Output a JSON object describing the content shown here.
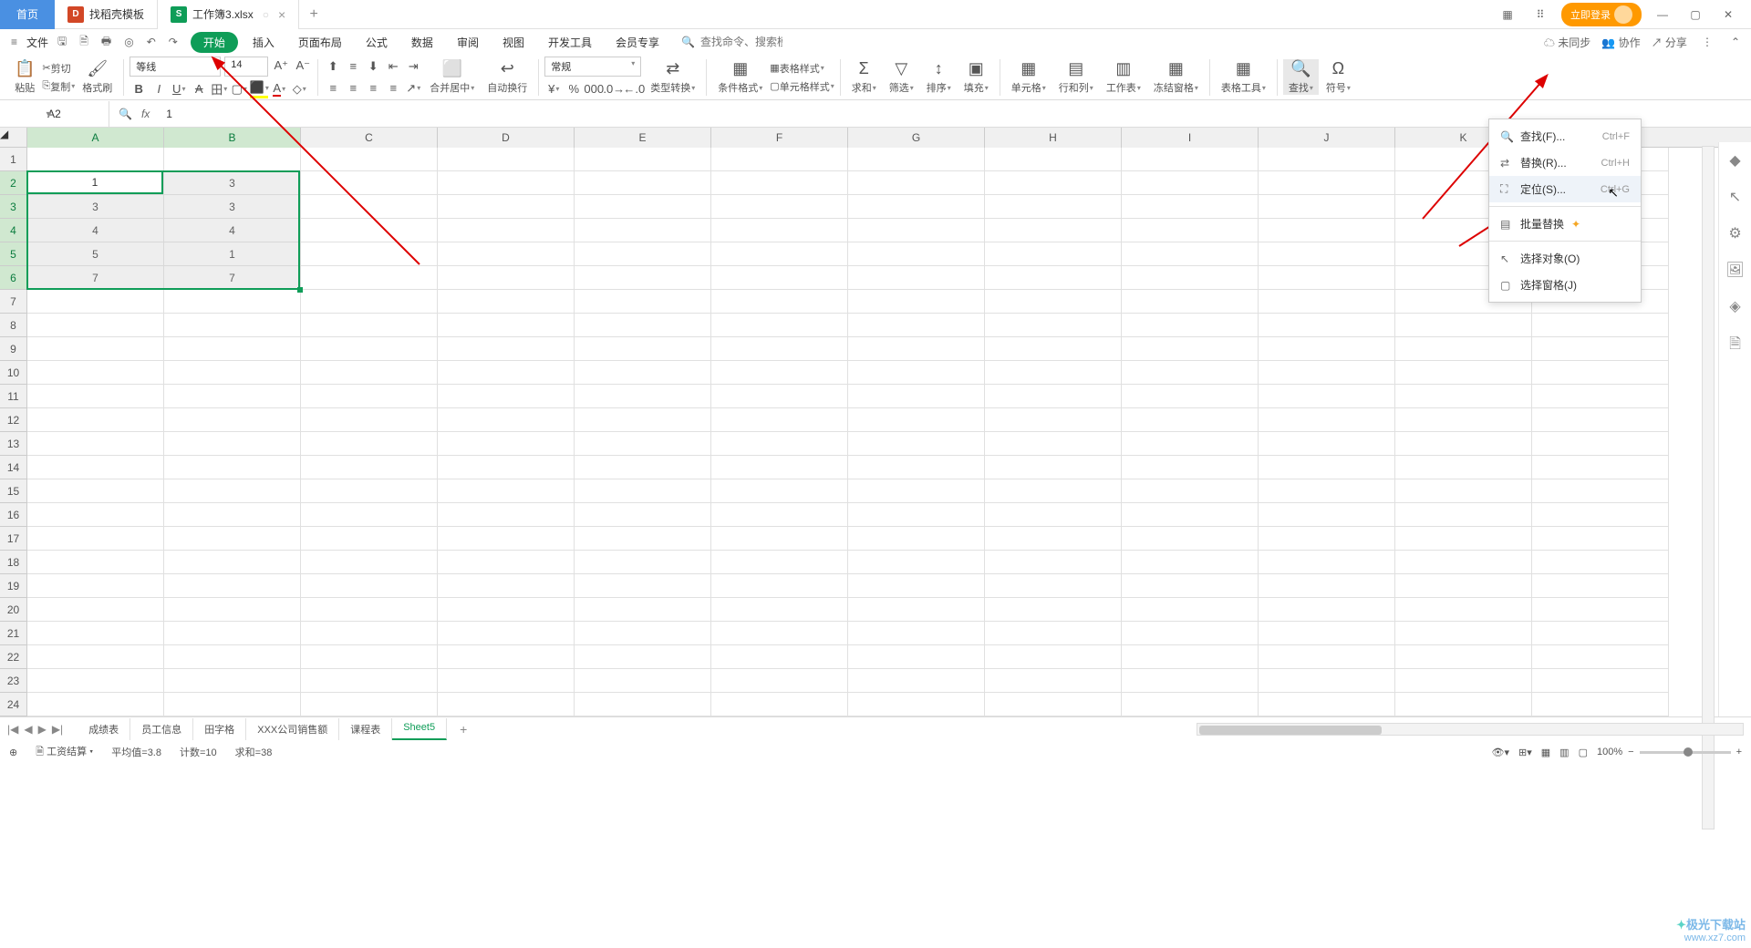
{
  "tabs": {
    "home": "首页",
    "tab1": "找稻壳模板",
    "tab2": "工作簿3.xlsx"
  },
  "title_right": {
    "login": "立即登录"
  },
  "menu": {
    "file": "文件",
    "items": [
      "开始",
      "插入",
      "页面布局",
      "公式",
      "数据",
      "审阅",
      "视图",
      "开发工具",
      "会员专享"
    ],
    "search_ph": "查找命令、搜索模板",
    "unsync": "未同步",
    "coop": "协作",
    "share": "分享"
  },
  "ribbon": {
    "paste": "粘贴",
    "cut": "剪切",
    "copy": "复制",
    "brush": "格式刷",
    "font": "等线",
    "size": "14",
    "merge": "合并居中",
    "wrap": "自动换行",
    "normal": "常规",
    "type_conv": "类型转换",
    "cond": "条件格式",
    "table_fmt": "表格样式",
    "cell_fmt": "单元格样式",
    "sum": "求和",
    "filter": "筛选",
    "sort": "排序",
    "fill": "填充",
    "cell": "单元格",
    "rowcol": "行和列",
    "sheet": "工作表",
    "freeze": "冻结窗格",
    "table_tool": "表格工具",
    "find": "查找",
    "symbol": "符号"
  },
  "name_box": "A2",
  "formula": "1",
  "columns": [
    "A",
    "B",
    "C",
    "D",
    "E",
    "F",
    "G",
    "H",
    "I",
    "J",
    "K"
  ],
  "col_widths": {
    "first": 150,
    "rest": 150
  },
  "data": {
    "r2": {
      "A": "1",
      "B": "3"
    },
    "r3": {
      "A": "3",
      "B": "3"
    },
    "r4": {
      "A": "4",
      "B": "4"
    },
    "r5": {
      "A": "5",
      "B": "1"
    },
    "r6": {
      "A": "7",
      "B": "7"
    }
  },
  "find_menu": {
    "find": "查找(F)...",
    "find_k": "Ctrl+F",
    "replace": "替换(R)...",
    "replace_k": "Ctrl+H",
    "goto": "定位(S)...",
    "goto_k": "Ctrl+G",
    "batch": "批量替换",
    "sel_obj": "选择对象(O)",
    "sel_pane": "选择窗格(J)"
  },
  "sheets": [
    "成绩表",
    "员工信息",
    "田字格",
    "XXX公司销售额",
    "课程表",
    "Sheet5"
  ],
  "status": {
    "doc": "工资结算",
    "avg": "平均值=3.8",
    "count": "计数=10",
    "sum": "求和=38",
    "zoom": "100%"
  },
  "watermark_brand": "极光下载站",
  "watermark_url": "www.xz7.com"
}
